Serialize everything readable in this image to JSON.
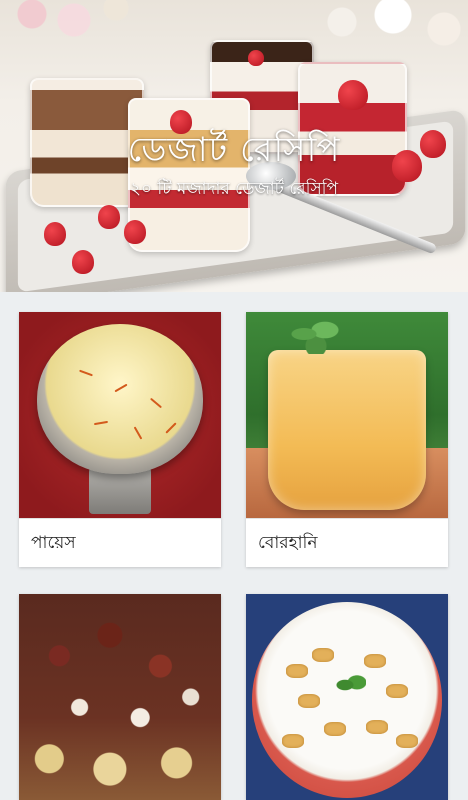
{
  "header": {
    "title": "ডেজার্ট রেসিপি",
    "subtitle": "২০ টি মজাদার ডেজার্ট রেসিপি"
  },
  "recipes": [
    {
      "label": "পায়েস",
      "image": "payesh-image"
    },
    {
      "label": "বোরহানি",
      "image": "borhani-image"
    },
    {
      "label": "",
      "image": "chaat-image"
    },
    {
      "label": "",
      "image": "doi-chira-image"
    }
  ],
  "colors": {
    "background": "#eceff1",
    "card": "#ffffff",
    "label_text": "#222222"
  }
}
